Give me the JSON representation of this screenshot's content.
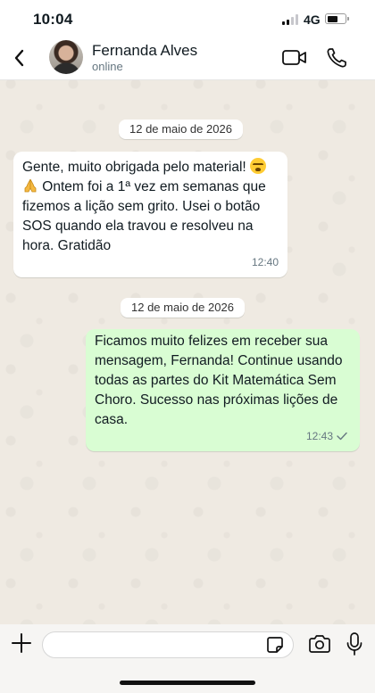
{
  "status_bar": {
    "time": "10:04",
    "network": "4G",
    "battery_level": 0.65
  },
  "header": {
    "contact_name": "Fernanda Alves",
    "contact_status": "online",
    "icons": [
      "chevron-left-icon",
      "video-icon",
      "phone-icon"
    ]
  },
  "messages": [
    {
      "date": "12 de maio de 2026",
      "direction": "incoming",
      "text_1": "Gente, muito obrigada pelo material! ",
      "emoji_1": "crying-face-emoji",
      "text_2": " Ontem foi a 1ª vez em semanas que fizemos a lição sem grito. Usei o botão SOS quando ela travou e resolveu na hora. Gratidão",
      "emoji_2": "folded-hands-emoji",
      "time": "12:40"
    },
    {
      "date": "12 de maio de 2026",
      "direction": "outgoing",
      "text": "Ficamos muito felizes em receber sua mensagem, Fernanda! Continue usando todas as partes do Kit Matemática Sem Choro. Sucesso nas próximas lições de casa.",
      "time": "12:43",
      "status": "sent"
    }
  ],
  "composer": {
    "value": "",
    "icons": [
      "plus-icon",
      "sticker-icon",
      "camera-icon",
      "microphone-icon"
    ]
  },
  "colors": {
    "chat_background": "#efeae2",
    "incoming_bubble": "#ffffff",
    "outgoing_bubble": "#d9fdd3",
    "meta_text": "#667781"
  }
}
